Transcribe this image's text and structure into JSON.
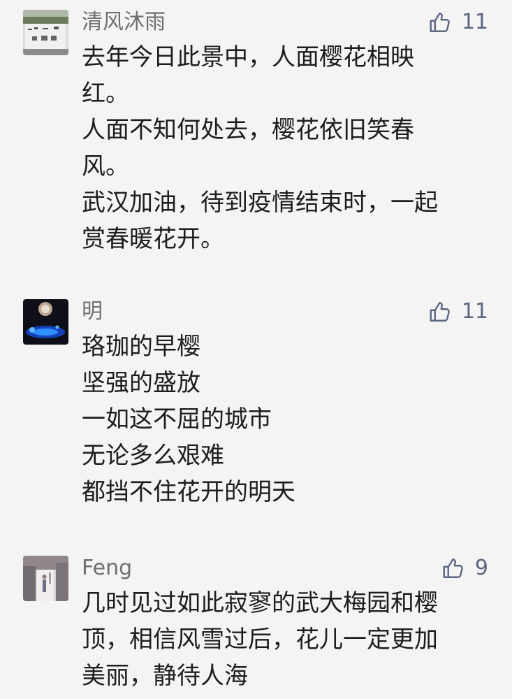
{
  "comments": [
    {
      "author": "清风沐雨",
      "likes": "11",
      "avatar_icon": "stone-tablet-photo",
      "lines": [
        "去年今日此景中，人面樱花相映",
        "红。",
        "人面不知何处去，樱花依旧笑春",
        "风。",
        "武汉加油，待到疫情结束时，一起",
        "赏春暖花开。"
      ]
    },
    {
      "author": "明",
      "likes": "11",
      "avatar_icon": "moon-water-photo",
      "lines": [
        "珞珈的早樱",
        "坚强的盛放",
        "一如这不屈的城市",
        "无论多么艰难",
        "都挡不住花开的明天"
      ]
    },
    {
      "author": "Feng",
      "likes": "9",
      "avatar_icon": "alley-photo",
      "lines": [
        "几时见过如此寂寥的武大梅园和樱",
        "顶，相信风雪过后，花儿一定更加",
        "美丽，静待人海"
      ]
    }
  ],
  "colors": {
    "background": "#f4f4f4",
    "name": "#6f6f6f",
    "like": "#5a6780",
    "text": "#1d1d1d"
  }
}
